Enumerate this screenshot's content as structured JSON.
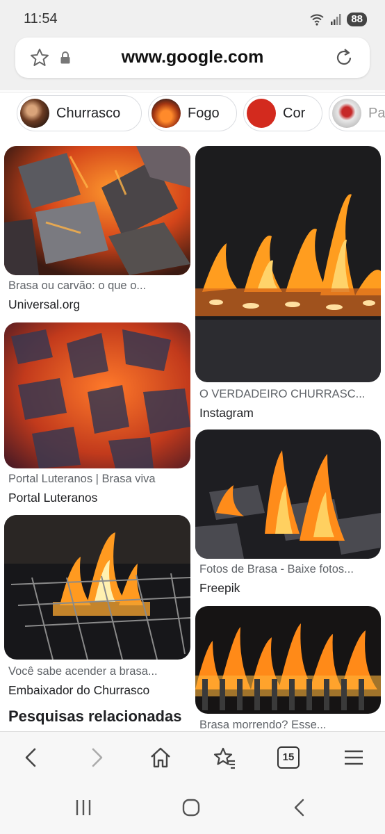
{
  "status": {
    "time": "11:54",
    "wifi_label": "5",
    "battery": "88"
  },
  "browser": {
    "url": "www.google.com"
  },
  "chips": [
    {
      "label": "Churrasco"
    },
    {
      "label": "Fogo"
    },
    {
      "label": "Cor"
    },
    {
      "label": "Pa"
    }
  ],
  "results": [
    {
      "title": "Brasa ou carvão: o que o...",
      "source": "Universal.org"
    },
    {
      "title": "O VERDADEIRO CHURRASC...",
      "source": "Instagram"
    },
    {
      "title": "Portal Luteranos | Brasa viva",
      "source": "Portal Luteranos"
    },
    {
      "title": "Fotos de Brasa - Baixe fotos...",
      "source": "Freepik"
    },
    {
      "title": "Você sabe acender a brasa...",
      "source": "Embaixador do Churrasco"
    },
    {
      "title": "Brasa morrendo? Esse...",
      "source": ""
    }
  ],
  "related_heading": "Pesquisas relacionadas",
  "toolbar": {
    "tabs_count": "15"
  },
  "colors": {
    "ember": "#e8531c",
    "flame": "#ffb02e",
    "charcoal": "#2a2a2e",
    "chip_red": "#d32a1e"
  }
}
